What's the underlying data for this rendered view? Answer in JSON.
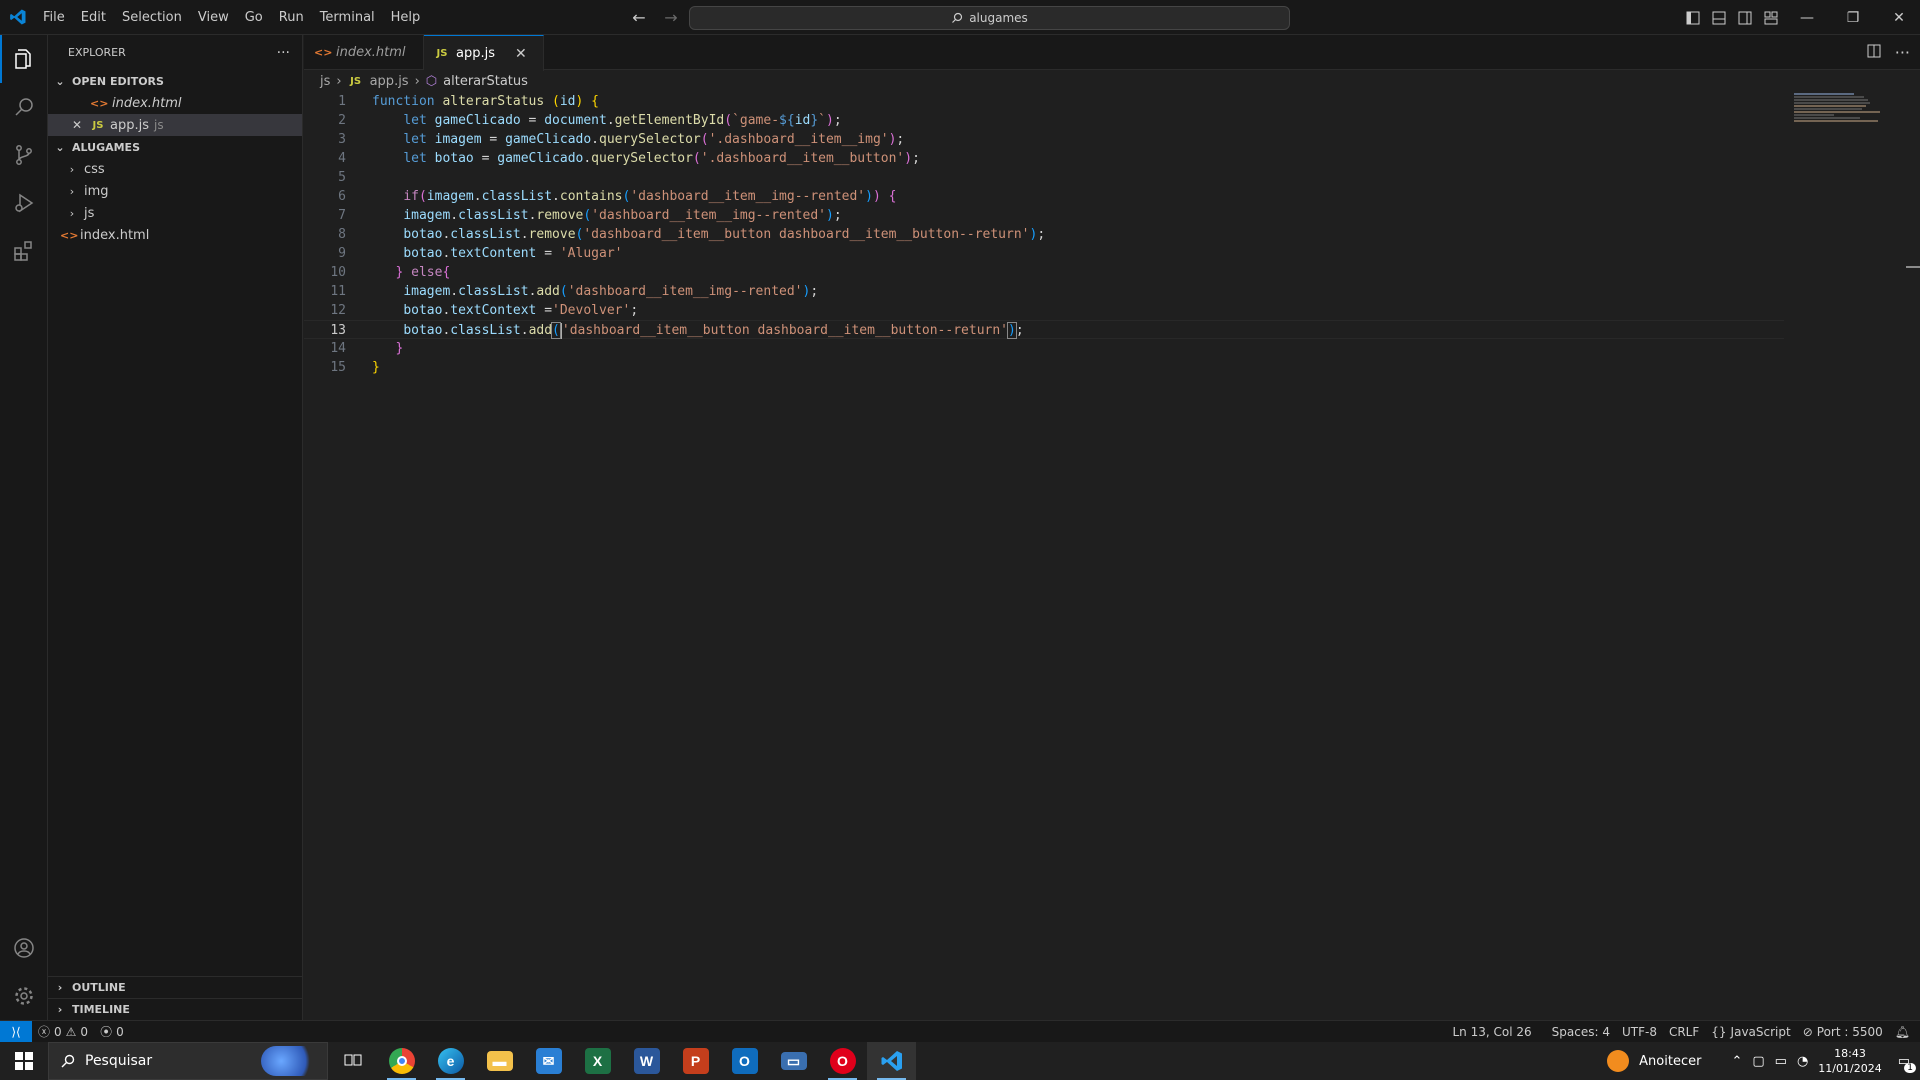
{
  "menu": [
    "File",
    "Edit",
    "Selection",
    "View",
    "Go",
    "Run",
    "Terminal",
    "Help"
  ],
  "command_center": {
    "text": "alugames"
  },
  "sidebar": {
    "title": "EXPLORER",
    "open_editors_label": "OPEN EDITORS",
    "open_editors": [
      {
        "name": "index.html"
      },
      {
        "name": "app.js",
        "dir": "js"
      }
    ],
    "workspace_label": "ALUGAMES",
    "tree": [
      {
        "name": "css"
      },
      {
        "name": "img"
      },
      {
        "name": "js"
      },
      {
        "name": "index.html"
      }
    ],
    "outline_label": "OUTLINE",
    "timeline_label": "TIMELINE"
  },
  "tabs": [
    {
      "label": "index.html"
    },
    {
      "label": "app.js"
    }
  ],
  "breadcrumb": {
    "folder": "js",
    "file": "app.js",
    "symbol": "alterarStatus"
  },
  "editor": {
    "line_numbers": [
      "1",
      "2",
      "3",
      "4",
      "5",
      "6",
      "7",
      "8",
      "9",
      "10",
      "11",
      "12",
      "13",
      "14",
      "15"
    ],
    "lines": [
      "function alterarStatus (id) {",
      "    let gameClicado = document.getElementById(`game-${id}`);",
      "    let imagem = gameClicado.querySelector('.dashboard__item__img');",
      "    let botao = gameClicado.querySelector('.dashboard__item__button');",
      "",
      "    if(imagem.classList.contains('dashboard__item__img--rented')) {",
      "    imagem.classList.remove('dashboard__item__img--rented');",
      "    botao.classList.remove('dashboard__item__button dashboard__item__button--return');",
      "    botao.textContent = 'Alugar'",
      "   } else{",
      "    imagem.classList.add('dashboard__item__img--rented');",
      "    botao.textContext ='Devolver';",
      "    botao.classList.add('dashboard__item__button dashboard__item__button--return');",
      "   }",
      "}"
    ]
  },
  "statusbar": {
    "errors": "0",
    "warnings": "0",
    "ports": "0",
    "position": "Ln 13, Col 26",
    "spaces": "Spaces: 4",
    "encoding": "UTF-8",
    "eol": "CRLF",
    "language": "JavaScript",
    "port": "Port : 5500"
  },
  "taskbar": {
    "search_placeholder": "Pesquisar",
    "weather": "Anoitecer",
    "time": "18:43",
    "date": "11/01/2024",
    "notifications": "1"
  },
  "colors": {
    "accent": "#0078d4",
    "editor_bg": "#1f1f1f",
    "chrome_bg": "#181818"
  }
}
